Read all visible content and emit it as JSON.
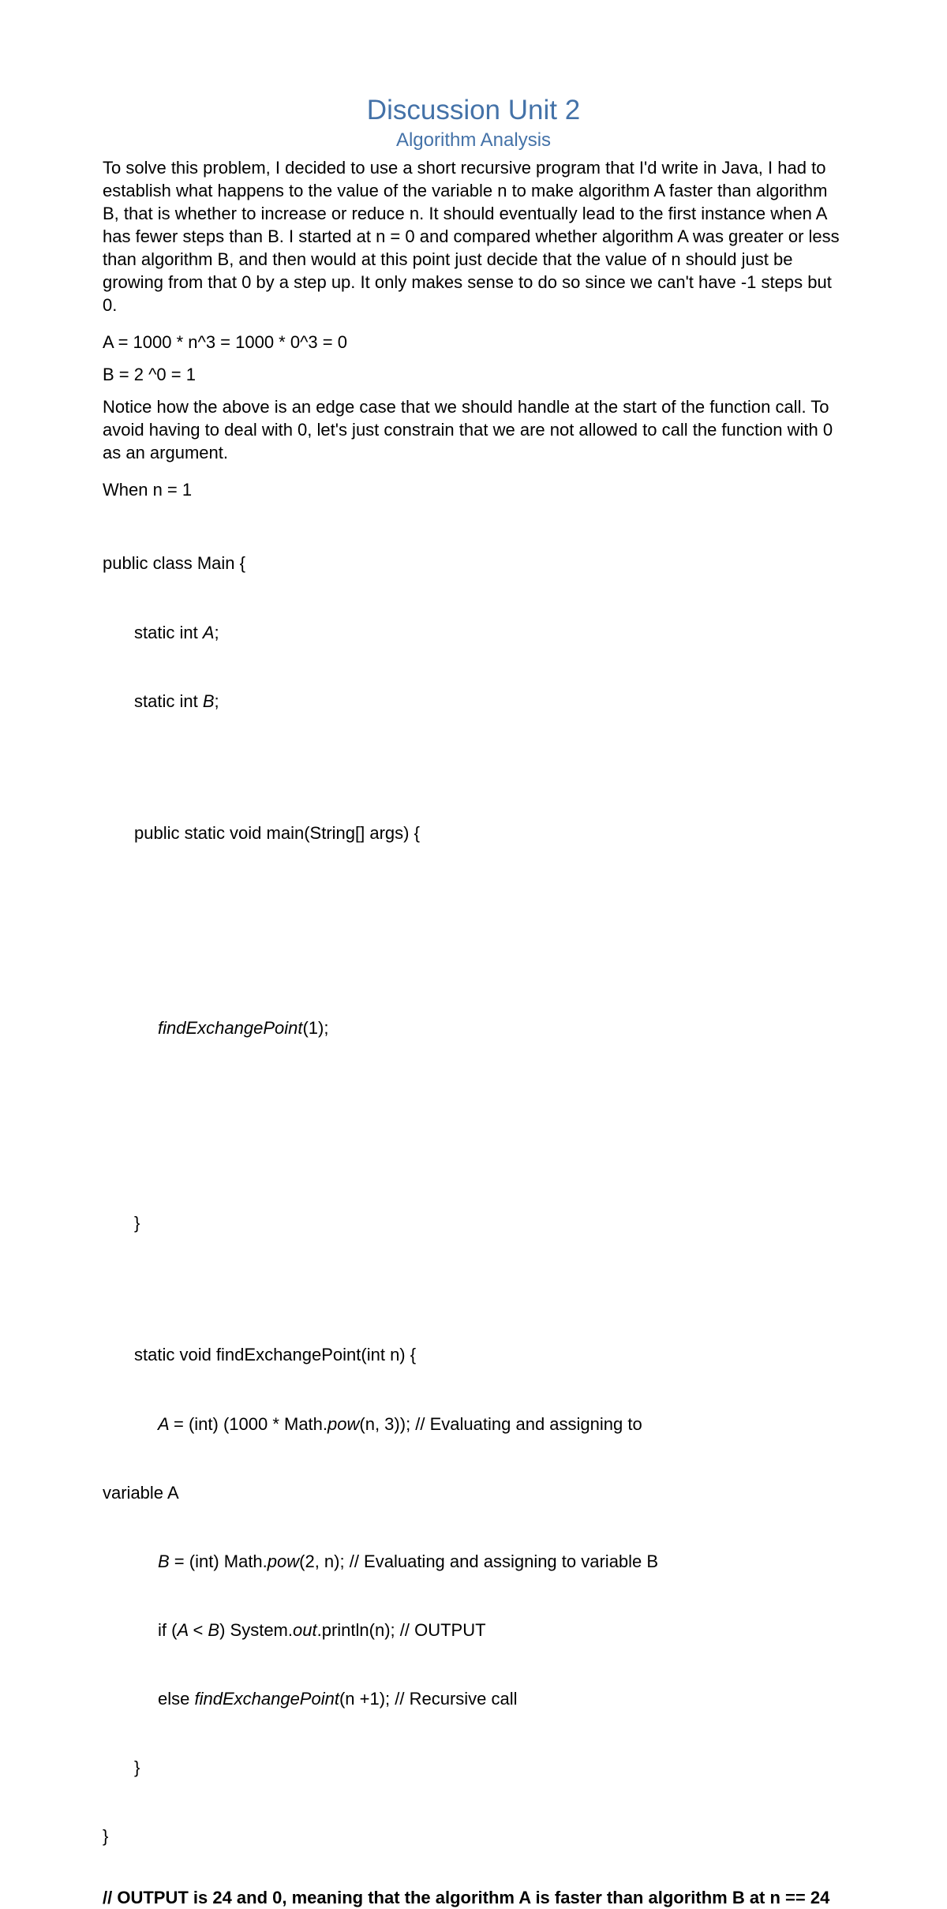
{
  "title": "Discussion Unit 2",
  "subtitle": "Algorithm Analysis",
  "paragraph1": "To solve this problem, I decided to use a short recursive program that I'd write in Java, I had to establish what happens to the value of the variable n to make algorithm A faster than algorithm B, that is whether to increase or reduce n. It should eventually lead to the first instance when A has fewer steps than B. I started at n = 0 and compared whether algorithm A was greater or less than algorithm B, and then would at this point just decide that the value of n should just be growing from that 0 by a step up. It only makes sense to do so since we can't have -1 steps but 0.",
  "equationA": "A = 1000 * n^3 = 1000 * 0^3 = 0",
  "equationB": "B = 2 ^0 = 1",
  "paragraph2": "Notice how the above is an edge case that we should handle at the start of the function call. To avoid having to deal with 0, let's just constrain that we are not allowed to call the function with 0 as an argument.",
  "whenN": "When n = 1",
  "code": {
    "line1": "public class Main {",
    "line2a": "static int ",
    "line2b": "A",
    "line2c": ";",
    "line3a": "static int ",
    "line3b": "B",
    "line3c": ";",
    "line4": "public static void main(String[] args) {",
    "line5a": "findExchangePoint",
    "line5b": "(1);",
    "line6": "}",
    "line7": "static void findExchangePoint(int n) {",
    "line8a": "A ",
    "line8b": "= (int) (1000 * Math.",
    "line8c": "pow",
    "line8d": "(n, 3)); // Evaluating and assigning to",
    "line8e": "variable A",
    "line9a": "B ",
    "line9b": "= (int) Math.",
    "line9c": "pow",
    "line9d": "(2, n); // Evaluating and assigning to variable B",
    "line10a": "if (",
    "line10b": "A ",
    "line10c": "< ",
    "line10d": "B",
    "line10e": ") System.",
    "line10f": "out",
    "line10g": ".println(n); // OUTPUT",
    "line11a": "else ",
    "line11b": "findExchangePoint",
    "line11c": "(n +1); // Recursive call",
    "line12": "}",
    "line13": "}"
  },
  "output": "// OUTPUT is 24 and 0, meaning that the algorithm A is faster than algorithm B at n == 24"
}
